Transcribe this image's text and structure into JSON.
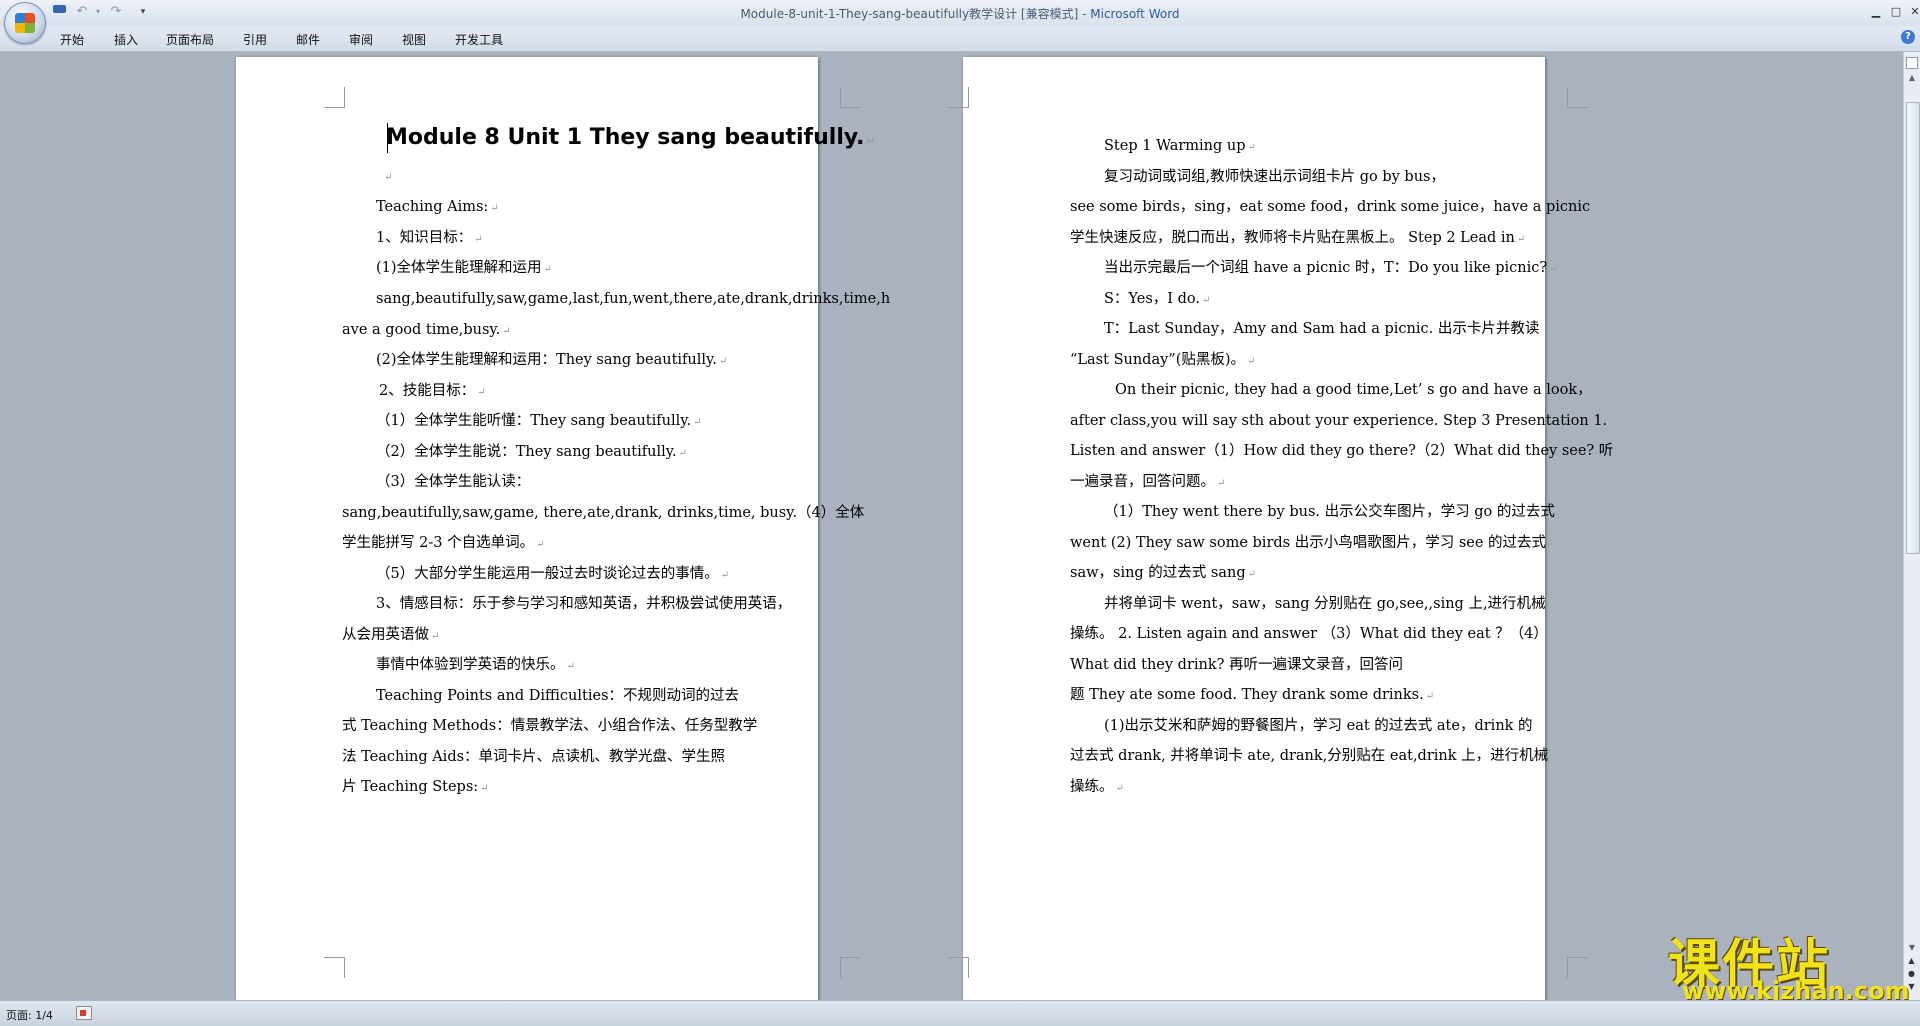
{
  "window": {
    "title_doc": "Module-8-unit-1-They-sang-beautifully教学设计 [兼容模式] - ",
    "title_app": "Microsoft Word"
  },
  "ribbon": {
    "tabs": [
      {
        "label": "开始"
      },
      {
        "label": "插入"
      },
      {
        "label": "页面布局"
      },
      {
        "label": "引用"
      },
      {
        "label": "邮件"
      },
      {
        "label": "审阅"
      },
      {
        "label": "视图"
      },
      {
        "label": "开发工具"
      }
    ]
  },
  "document": {
    "title": "Module 8 Unit 1 They sang beautifully.",
    "left_lines": [
      "Teaching Aims:",
      "1、知识目标：",
      "(1)全体学生能理解和运用",
      "sang,beautifully,saw,game,last,fun,went,there,ate,drank,drinks,time,h",
      "ave a good time,busy.",
      "(2)全体学生能理解和运用：They sang beautifully.",
      "2、技能目标：",
      "（1）全体学生能听懂：They sang beautifully.",
      "（2）全体学生能说：They sang beautifully.",
      "（3）全体学生能认读：",
      "sang,beautifully,saw,game, there,ate,drank, drinks,time, busy.（4）全体",
      "学生能拼写 2-3 个自选单词。",
      "（5）大部分学生能运用一般过去时谈论过去的事情。",
      "3、情感目标：乐于参与学习和感知英语，并积极尝试使用英语，",
      "从会用英语做",
      "事情中体验到学英语的快乐。",
      "Teaching Points and Difficulties：不规则动词的过去",
      "式 Teaching Methods：情景教学法、小组合作法、任务型教学",
      "法 Teaching Aids：单词卡片、点读机、教学光盘、学生照",
      "片 Teaching Steps:"
    ],
    "right_lines": [
      "Step 1 Warming up",
      "复习动词或词组,教师快速出示词组卡片 go by bus，",
      "see some birds，sing，eat some food，drink some juice，have a picnic",
      "学生快速反应，脱口而出，教师将卡片贴在黑板上。 Step 2 Lead in",
      "当出示完最后一个词组 have a picnic 时，T：Do you like picnic?",
      "S：Yes，I do.",
      "T：Last Sunday，Amy and Sam had a picnic. 出示卡片并教读",
      "“Last Sunday”(贴黑板)。",
      "On their picnic, they had a good time,Let’ s go and have a look，",
      "after class,you will say sth about your experience. Step 3  Presentation 1.",
      "Listen and answer（1）How did they go there?（2）What did they see?  听",
      "一遍录音，回答问题。",
      "（1）They went there by bus. 出示公交车图片，学习 go 的过去式",
      "went (2) They saw some birds 出示小鸟唱歌图片，学习 see 的过去式",
      "saw，sing 的过去式 sang",
      "并将单词卡 went，saw，sang 分别贴在 go,see,,sing 上,进行机械",
      "操练。 2. Listen again and answer  （3）What did they eat ？（4）",
      "What did they drink? 再听一遍课文录音，回答问",
      "题   They ate some food. They drank some drinks.",
      "(1)出示艾米和萨姆的野餐图片，学习 eat 的过去式 ate，drink 的",
      "过去式 drank, 并将单词卡 ate, drank,分别贴在 eat,drink 上，进行机械",
      "操练。"
    ]
  },
  "statusbar": {
    "page_info": "页面: 1/4"
  },
  "watermark": {
    "title": "课件站",
    "url": "www.kjzhan.com"
  }
}
